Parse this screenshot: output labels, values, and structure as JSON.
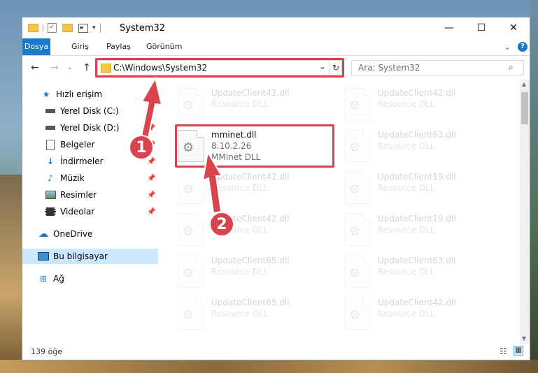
{
  "window": {
    "title": "System32",
    "minimize": "—",
    "maximize": "☐",
    "close": "✕"
  },
  "ribbon": {
    "tabs": [
      "Dosya",
      "Giriş",
      "Paylaş",
      "Görünüm"
    ],
    "help": "?",
    "collapse": "⌄"
  },
  "address": {
    "path": "C:\\Windows\\System32",
    "search_placeholder": "Ara: System32"
  },
  "nav": {
    "items": [
      {
        "label": "Hızlı erişim"
      },
      {
        "label": "Yerel Disk (C:)"
      },
      {
        "label": "Yerel Disk (D:)"
      },
      {
        "label": "Belgeler"
      },
      {
        "label": "İndirmeler"
      },
      {
        "label": "Müzik"
      },
      {
        "label": "Resimler"
      },
      {
        "label": "Videolar"
      },
      {
        "label": "OneDrive"
      },
      {
        "label": "Bu bilgisayar"
      },
      {
        "label": "Ağ"
      }
    ]
  },
  "files": {
    "highlighted": {
      "name": "mminet.dll",
      "version": "8.10.2.26",
      "desc": "MMInet DLL"
    },
    "faded": [
      {
        "name": "UpdateClient42.dll",
        "desc": "Resource DLL"
      },
      {
        "name": "UpdateClient42.dll",
        "desc": "Resource DLL"
      },
      {
        "name": "UpdateClient63.dll",
        "desc": "Resource DLL"
      },
      {
        "name": "UpdateClient42.dll",
        "desc": "Resource DLL"
      },
      {
        "name": "UpdateClient19.dll",
        "desc": "Resource DLL"
      },
      {
        "name": "UpdateClient42.dll",
        "desc": "Resource DLL"
      },
      {
        "name": "UpdateClient19.dll",
        "desc": "Resource DLL"
      },
      {
        "name": "UpdateClient65.dll",
        "desc": "Resource DLL"
      },
      {
        "name": "UpdateClient63.dll",
        "desc": "Resource DLL"
      },
      {
        "name": "UpdateClient65.dll",
        "desc": "Resource DLL"
      },
      {
        "name": "UpdateClient42.dll",
        "desc": "Resource DLL"
      }
    ]
  },
  "status": {
    "count": "139 öğe"
  },
  "callouts": {
    "one": "1",
    "two": "2"
  },
  "colors": {
    "accent": "#1979ca",
    "highlight": "#d9434e",
    "selected": "#cce8ff"
  }
}
